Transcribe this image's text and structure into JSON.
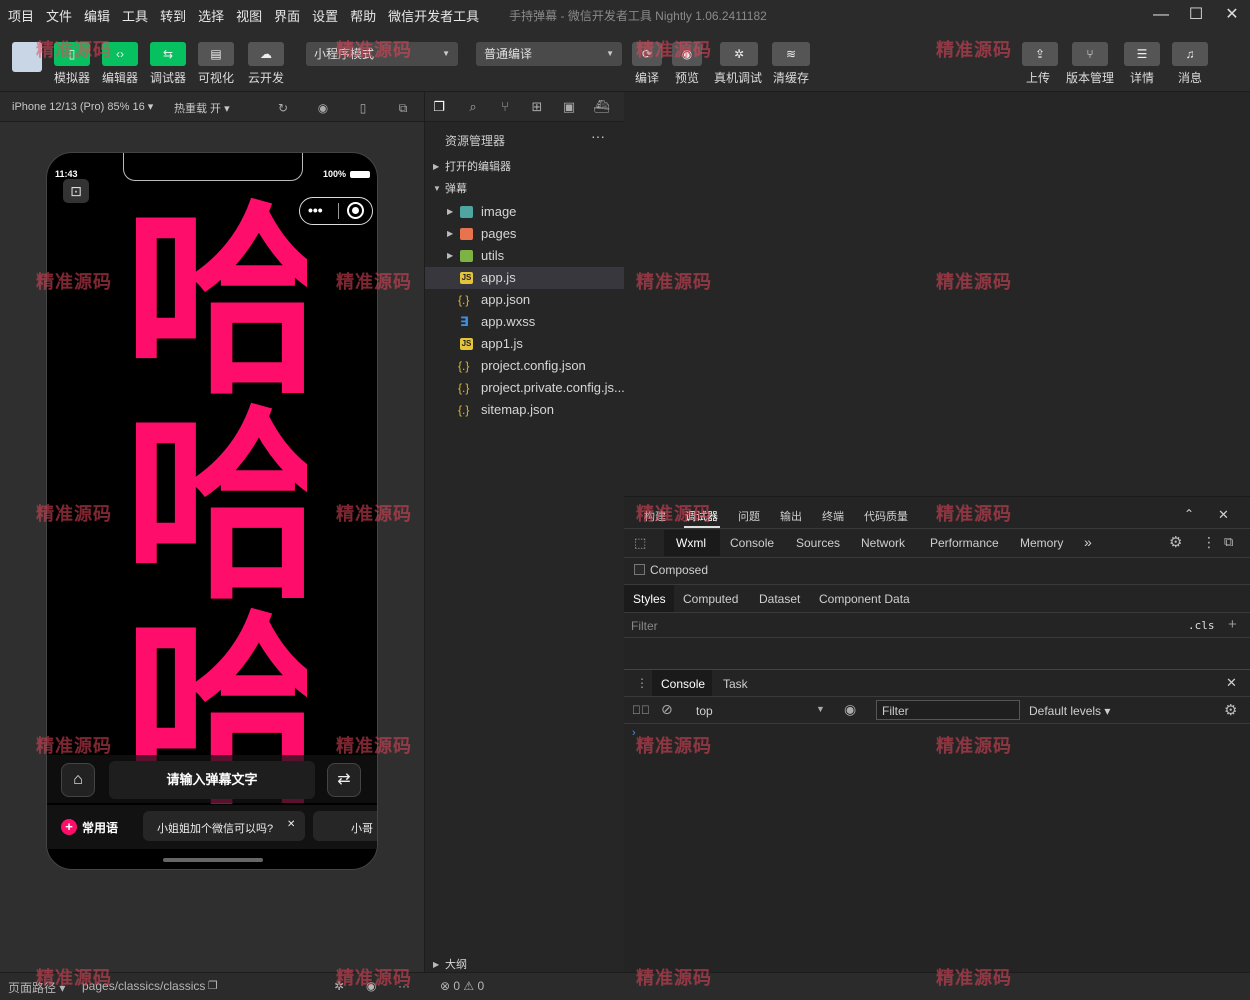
{
  "menu": {
    "items": [
      "项目",
      "文件",
      "编辑",
      "工具",
      "转到",
      "选择",
      "视图",
      "界面",
      "设置",
      "帮助",
      "微信开发者工具"
    ],
    "window_title": "手持弹幕 - 微信开发者工具 Nightly 1.06.2411182"
  },
  "toolbar": {
    "simulator": "模拟器",
    "editor": "编辑器",
    "debugger": "调试器",
    "visual": "可视化",
    "cloud": "云开发",
    "mode_select": "小程序模式",
    "compile_select": "普通编译",
    "compile": "编译",
    "preview": "预览",
    "device_debug": "真机调试",
    "clear_cache": "清缓存",
    "upload": "上传",
    "version": "版本管理",
    "details": "详情",
    "messages": "消息"
  },
  "simbar": {
    "device": "iPhone 12/13 (Pro) 85% 16 ▾",
    "hotreload": "热重载 开 ▾"
  },
  "phone": {
    "time": "11:43",
    "battery": "100%",
    "danmaku_text": "哈哈哈",
    "input_placeholder": "请输入弹幕文字",
    "phrase_label": "常用语",
    "phrase_chip": "小姐姐加个微信可以吗?",
    "phrase_chip2": "小哥"
  },
  "explorer": {
    "title": "资源管理器",
    "open_editors": "打开的编辑器",
    "project": "弹幕",
    "files": [
      {
        "name": "image",
        "type": "folder"
      },
      {
        "name": "pages",
        "type": "folder"
      },
      {
        "name": "utils",
        "type": "folder"
      },
      {
        "name": "app.js",
        "type": "js"
      },
      {
        "name": "app.json",
        "type": "json"
      },
      {
        "name": "app.wxss",
        "type": "css"
      },
      {
        "name": "app1.js",
        "type": "js"
      },
      {
        "name": "project.config.json",
        "type": "json"
      },
      {
        "name": "project.private.config.js...",
        "type": "json"
      },
      {
        "name": "sitemap.json",
        "type": "json"
      }
    ],
    "outline": "大纲"
  },
  "devtools": {
    "top_tabs": [
      "构建",
      "调试器",
      "问题",
      "输出",
      "终端",
      "代码质量"
    ],
    "panel_tabs": [
      "Wxml",
      "Console",
      "Sources",
      "Network",
      "Performance",
      "Memory"
    ],
    "composed": "Composed",
    "style_tabs": [
      "Styles",
      "Computed",
      "Dataset",
      "Component Data"
    ],
    "filter_placeholder": "Filter",
    "cls": ".cls",
    "drawer_tabs": [
      "Console",
      "Task"
    ],
    "context": "top",
    "console_filter": "Filter",
    "levels": "Default levels ▾"
  },
  "statusbar": {
    "path_label": "页面路径 ▾",
    "path": "pages/classics/classics",
    "errors": "⊗ 0 ⚠ 0"
  },
  "watermark": "精准源码",
  "colors": {
    "accent_green": "#07c160",
    "danmaku_pink": "#ff0d6a"
  }
}
